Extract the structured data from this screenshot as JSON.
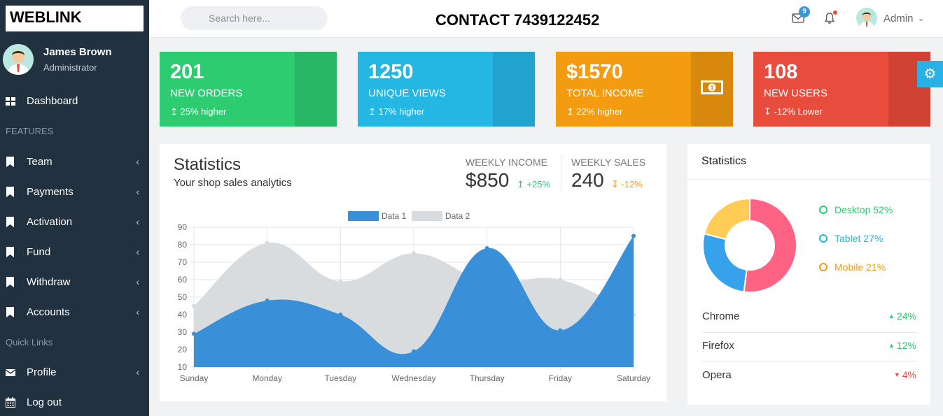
{
  "brand": "WEBLINK",
  "contact": "CONTACT 7439122452",
  "search": {
    "placeholder": "Search here..."
  },
  "topbar": {
    "mail_count": "9",
    "admin_label": "Admin"
  },
  "user": {
    "name": "James Brown",
    "role": "Administrator"
  },
  "sidebar": {
    "dashboard": "Dashboard",
    "features_heading": "FEATURES",
    "items": [
      {
        "label": "Team"
      },
      {
        "label": "Payments"
      },
      {
        "label": "Activation"
      },
      {
        "label": "Fund"
      },
      {
        "label": "Withdraw"
      },
      {
        "label": "Accounts"
      }
    ],
    "quick_links_heading": "Quick Links",
    "profile": "Profile",
    "logout": "Log out"
  },
  "cards": [
    {
      "value": "201",
      "title": "NEW ORDERS",
      "sub": "25% higher",
      "color": "#2ecc71",
      "stripe": "#27b765"
    },
    {
      "value": "1250",
      "title": "UNIQUE VIEWS",
      "sub": "17% higher",
      "color": "#25b7e4",
      "stripe": "#20a3cc"
    },
    {
      "value": "$1570",
      "title": "TOTAL INCOME",
      "sub": "22% higher",
      "color": "#f39c12",
      "stripe": "#d8890d"
    },
    {
      "value": "108",
      "title": "NEW USERS",
      "sub": "-12% Lower",
      "color": "#e74c3c",
      "stripe": "#cf4234"
    }
  ],
  "stats": {
    "title": "Statistics",
    "subtitle": "Your shop sales analytics",
    "weekly_income_label": "WEEKLY INCOME",
    "weekly_income_value": "$850",
    "weekly_income_change": "+25%",
    "weekly_sales_label": "WEEKLY SALES",
    "weekly_sales_value": "240",
    "weekly_sales_change": "-12%"
  },
  "chart_data": {
    "type": "area",
    "categories": [
      "Sunday",
      "Monday",
      "Tuesday",
      "Wednesday",
      "Thursday",
      "Friday",
      "Saturday"
    ],
    "series": [
      {
        "name": "Data 1",
        "values": [
          29,
          48,
          40,
          19,
          78,
          31,
          85
        ],
        "color": "#3a8fd9"
      },
      {
        "name": "Data 2",
        "values": [
          45,
          81,
          59,
          75,
          59,
          60,
          40
        ],
        "color": "#d9dcdf"
      }
    ],
    "ylim": [
      10,
      90
    ],
    "yticks": [
      10,
      20,
      30,
      40,
      50,
      60,
      70,
      80,
      90
    ],
    "legend": "top",
    "grid": true
  },
  "right_panel": {
    "title": "Statistics",
    "devices": [
      {
        "label": "Desktop 52%",
        "value": 52,
        "color": "#ff6384",
        "text_color": "#2ecc71"
      },
      {
        "label": "Tablet 27%",
        "value": 27,
        "color": "#36a2eb",
        "text_color": "#25b7e4"
      },
      {
        "label": "Mobile 21%",
        "value": 21,
        "color": "#ffcd56",
        "text_color": "#f39c12"
      }
    ],
    "browsers": [
      {
        "name": "Chrome",
        "change": "24%",
        "dir": "up",
        "color": "#2ecc71"
      },
      {
        "name": "Firefox",
        "change": "12%",
        "dir": "up",
        "color": "#2ecc71"
      },
      {
        "name": "Opera",
        "change": "4%",
        "dir": "down",
        "color": "#e74c3c"
      }
    ]
  }
}
